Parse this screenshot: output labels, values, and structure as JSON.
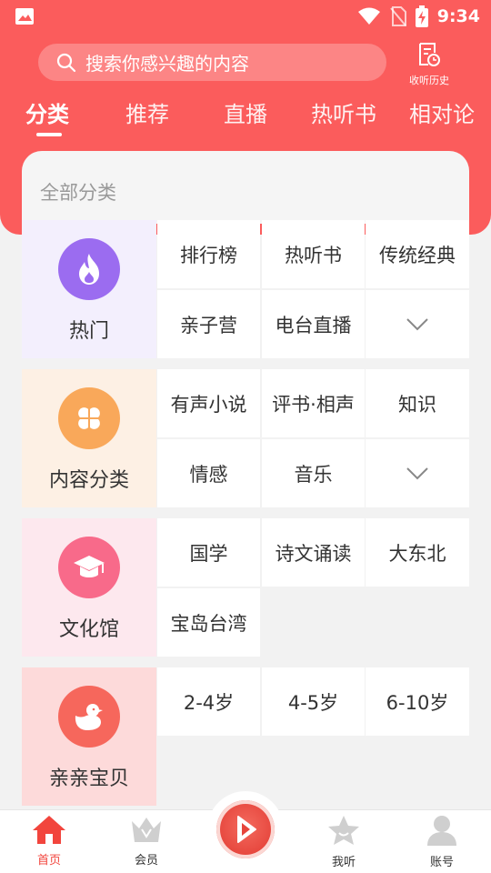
{
  "status_bar": {
    "time": "9:34"
  },
  "search": {
    "placeholder": "搜索你感兴趣的内容"
  },
  "history": {
    "label": "收听历史"
  },
  "tabs": [
    {
      "label": "分类",
      "active": true
    },
    {
      "label": "推荐"
    },
    {
      "label": "直播"
    },
    {
      "label": "热听书"
    },
    {
      "label": "相对论"
    }
  ],
  "all_categories_title": "全部分类",
  "sections": [
    {
      "name": "热门",
      "icon": "flame-icon",
      "color": "#9b6cf0",
      "items": [
        "排行榜",
        "热听书",
        "传统经典",
        "亲子营",
        "电台直播"
      ]
    },
    {
      "name": "内容分类",
      "icon": "clover-icon",
      "color": "#f9a85a",
      "items": [
        "有声小说",
        "评书·相声",
        "知识",
        "情感",
        "音乐"
      ]
    },
    {
      "name": "文化馆",
      "icon": "graduation-cap-icon",
      "color": "#f86a8a",
      "items": [
        "国学",
        "诗文诵读",
        "大东北",
        "宝岛台湾"
      ]
    },
    {
      "name": "亲亲宝贝",
      "icon": "duck-icon",
      "color": "#f6675c",
      "items": [
        "2-4岁",
        "4-5岁",
        "6-10岁"
      ]
    }
  ],
  "bottom_nav": [
    {
      "label": "首页",
      "icon": "home-icon",
      "active": true
    },
    {
      "label": "会员",
      "icon": "crown-icon"
    },
    {
      "label": "我听",
      "icon": "star-icon"
    },
    {
      "label": "账号",
      "icon": "user-icon"
    }
  ],
  "colors": {
    "primary": "#fb5c5c",
    "active_nav": "#f2453d"
  }
}
